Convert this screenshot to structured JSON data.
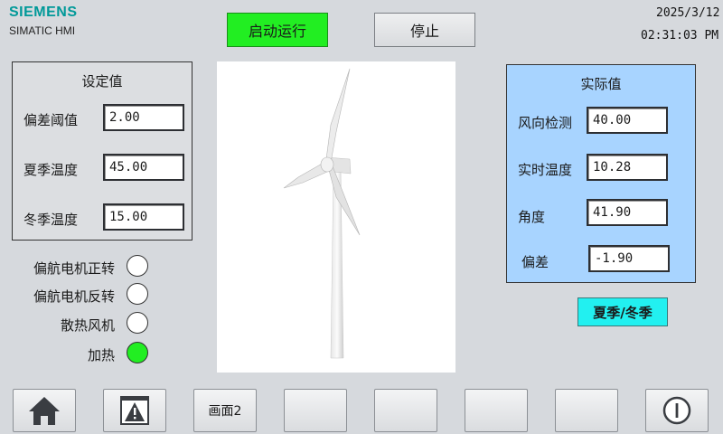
{
  "header": {
    "brand": "SIEMENS",
    "product": "SIMATIC HMI",
    "date": "2025/3/12",
    "time": "02:31:03 PM",
    "start_label": "启动运行",
    "stop_label": "停止"
  },
  "setpoints": {
    "title": "设定值",
    "rows": [
      {
        "label": "偏差阈值",
        "value": "2.00"
      },
      {
        "label": "夏季温度",
        "value": "45.00"
      },
      {
        "label": "冬季温度",
        "value": "15.00"
      }
    ]
  },
  "indicators": [
    {
      "label": "偏航电机正转",
      "state": "off",
      "color": "#ffffff"
    },
    {
      "label": "偏航电机反转",
      "state": "off",
      "color": "#ffffff"
    },
    {
      "label": "散热风机",
      "state": "off",
      "color": "#ffffff"
    },
    {
      "label": "加热",
      "state": "on",
      "color": "#22ee22"
    }
  ],
  "actuals": {
    "title": "实际值",
    "rows": [
      {
        "label": "风向检测",
        "value": "40.00"
      },
      {
        "label": "实时温度",
        "value": "10.28"
      },
      {
        "label": "角度",
        "value": "41.90"
      },
      {
        "label": "偏差",
        "value": "-1.90"
      }
    ]
  },
  "season_button": "夏季/冬季",
  "nav": {
    "home_icon": "home-icon",
    "alarm_icon": "alarm-warning-icon",
    "screen2_label": "画面2",
    "power_icon": "power-icon"
  },
  "colors": {
    "start_button": "#22ee22",
    "actual_panel": "#a8d4ff",
    "season_button": "#22f0f0",
    "brand": "#009999"
  }
}
